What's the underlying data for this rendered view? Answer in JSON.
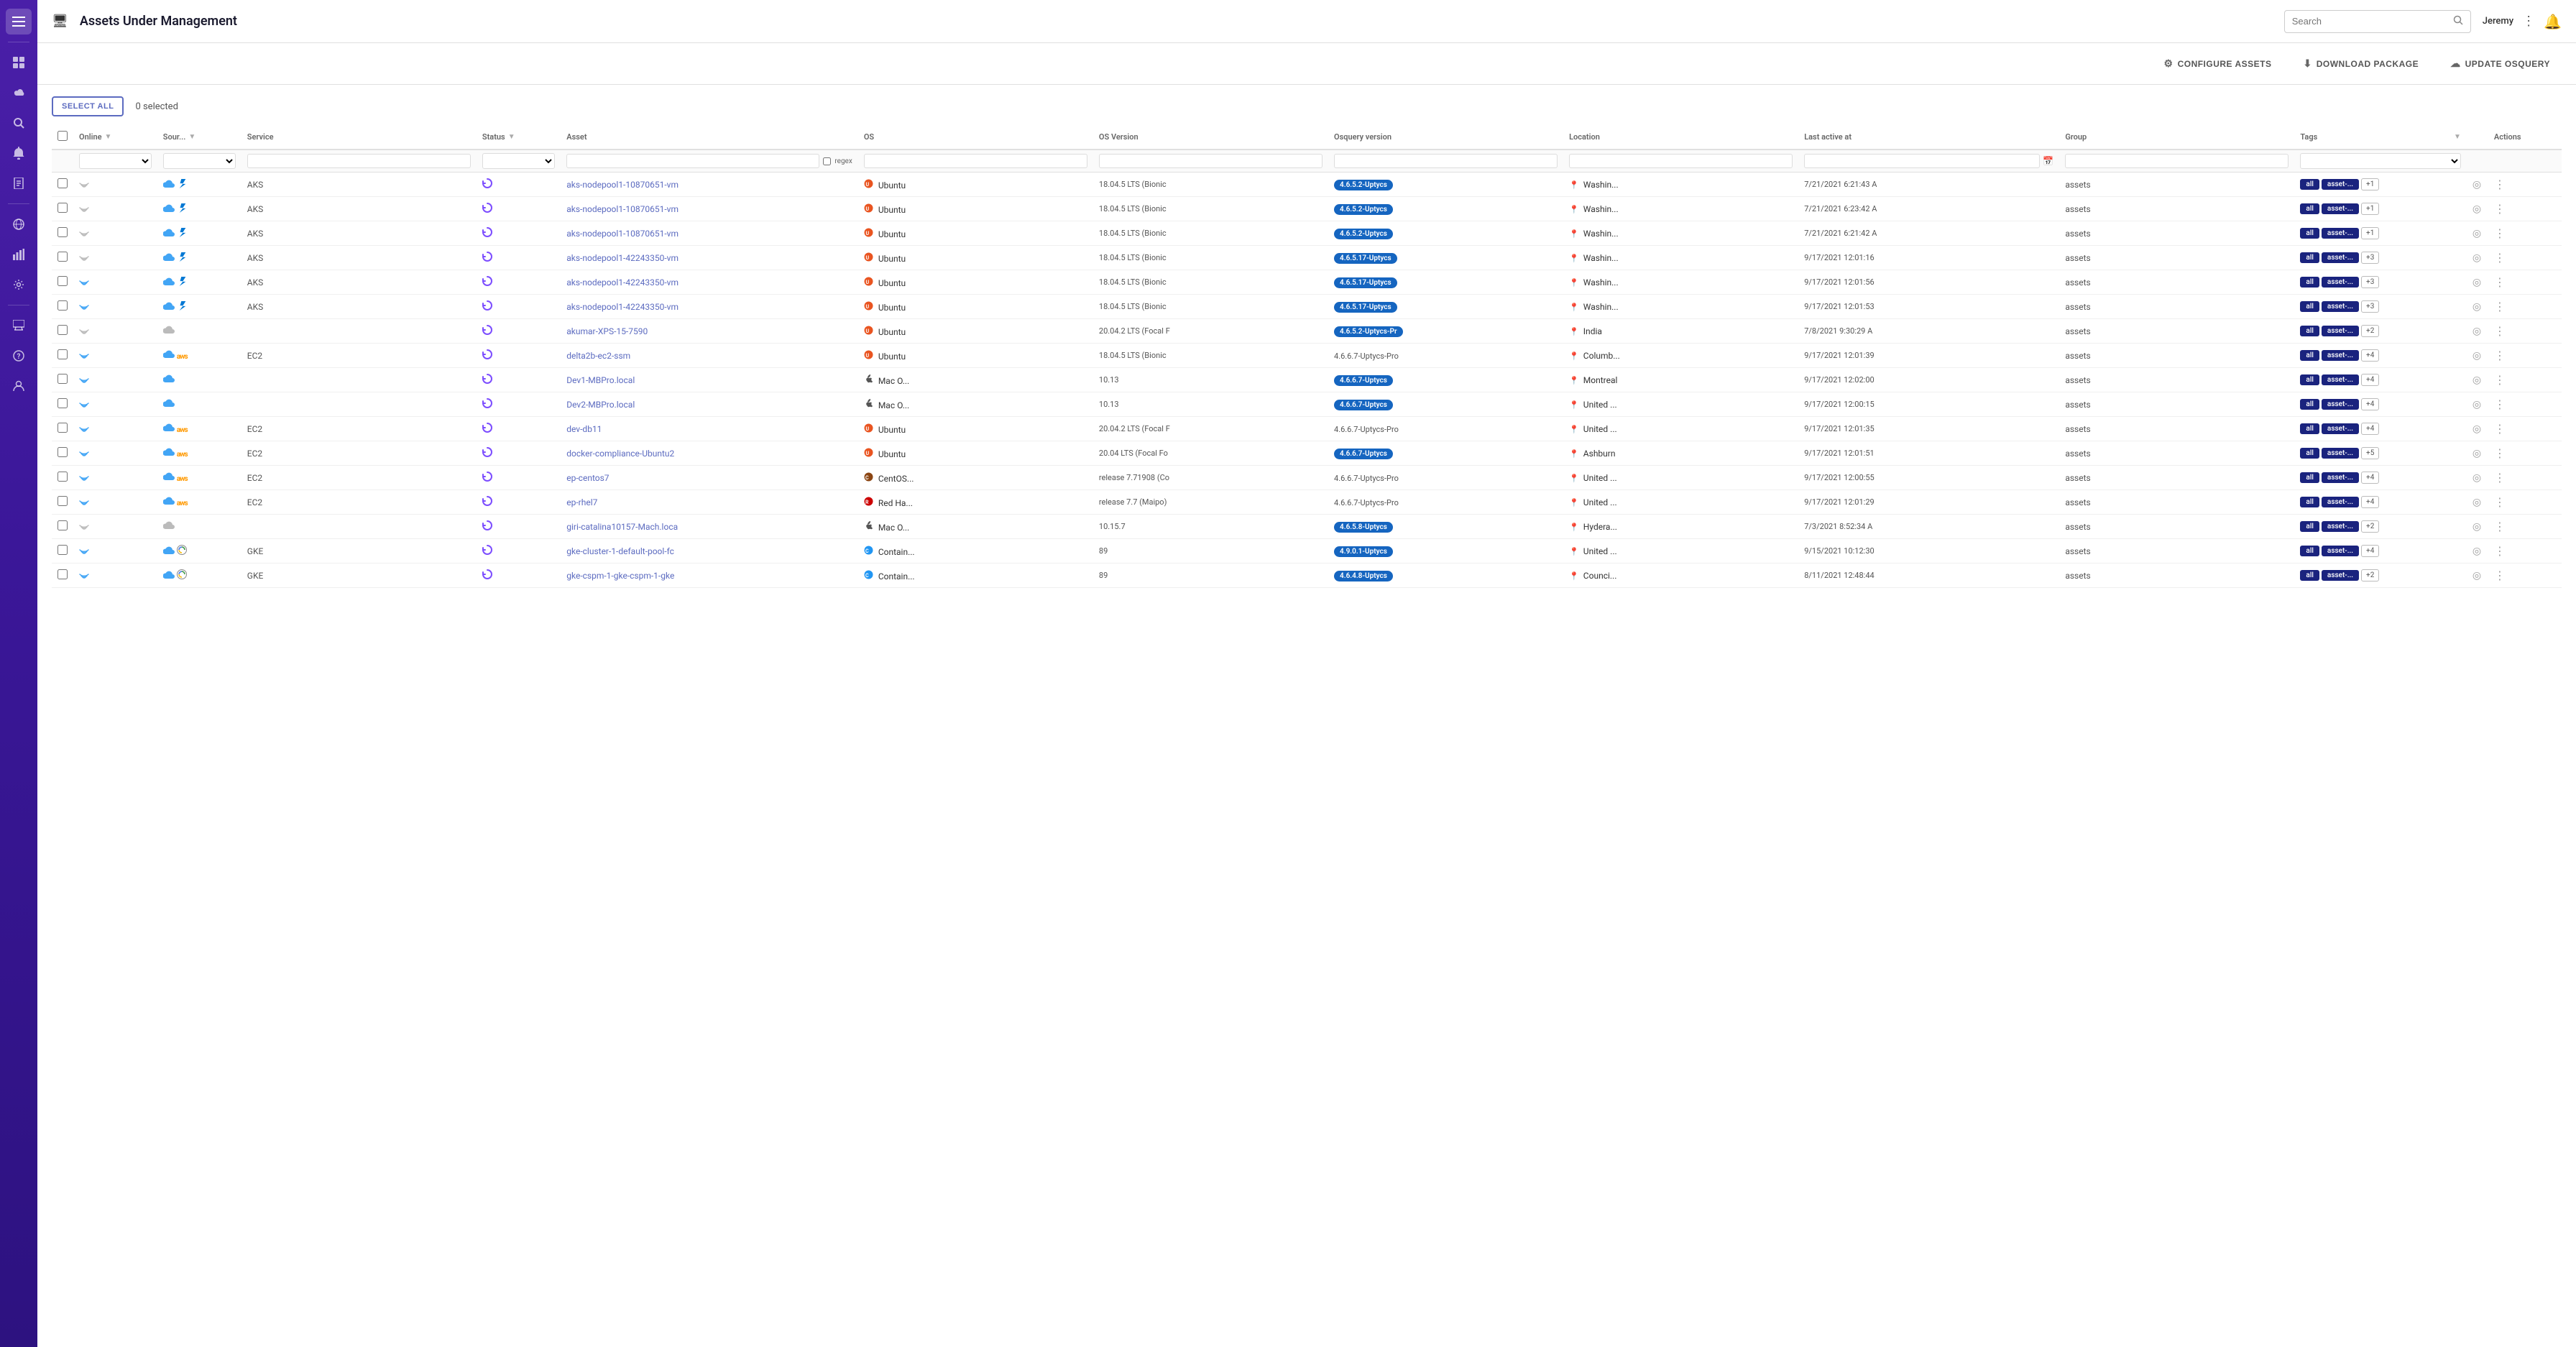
{
  "app": {
    "title": "Assets Under Management",
    "monitor_icon": "🖥",
    "hamburger_label": "☰"
  },
  "topbar": {
    "search_placeholder": "Search",
    "user_name": "Jeremy",
    "notification_icon": "🔔",
    "more_icon": "⋮"
  },
  "action_bar": {
    "configure_label": "CONFIGURE ASSETS",
    "download_label": "DOWNLOAD PACKAGE",
    "update_label": "UPDATE OSQUERY",
    "gear_icon": "⚙",
    "download_icon": "⬇",
    "cloud_icon": "☁"
  },
  "table": {
    "select_all_label": "SELECT ALL",
    "selected_count": "0 selected",
    "columns": [
      "",
      "Online",
      "Sour...",
      "Service",
      "Status",
      "Asset",
      "OS",
      "OS Version",
      "Osquery version",
      "Location",
      "Last active at",
      "Group",
      "Tags",
      "",
      "Actions"
    ],
    "regex_label": "regex",
    "rows": [
      {
        "online": "offline",
        "source": "cloud",
        "source_type": "azure",
        "service": "AKS",
        "status": "sync",
        "asset": "aks-nodepool1-10870651-vm",
        "os": "ubuntu",
        "os_name": "Ubuntu",
        "os_version": "18.04.5 LTS (Bionic",
        "osquery": "4.6.5.2-Uptycs",
        "location": "Washin...",
        "last_active": "7/21/2021 6:21:43 A",
        "group": "assets",
        "tags": [
          "all",
          "asset-...",
          "+1"
        ]
      },
      {
        "online": "offline",
        "source": "cloud",
        "source_type": "azure",
        "service": "AKS",
        "status": "sync",
        "asset": "aks-nodepool1-10870651-vm",
        "os": "ubuntu",
        "os_name": "Ubuntu",
        "os_version": "18.04.5 LTS (Bionic",
        "osquery": "4.6.5.2-Uptycs",
        "location": "Washin...",
        "last_active": "7/21/2021 6:23:42 A",
        "group": "assets",
        "tags": [
          "all",
          "asset-...",
          "+1"
        ]
      },
      {
        "online": "offline",
        "source": "cloud",
        "source_type": "azure",
        "service": "AKS",
        "status": "sync",
        "asset": "aks-nodepool1-10870651-vm",
        "os": "ubuntu",
        "os_name": "Ubuntu",
        "os_version": "18.04.5 LTS (Bionic",
        "osquery": "4.6.5.2-Uptycs",
        "location": "Washin...",
        "last_active": "7/21/2021 6:21:42 A",
        "group": "assets",
        "tags": [
          "all",
          "asset-...",
          "+1"
        ]
      },
      {
        "online": "offline",
        "source": "cloud",
        "source_type": "azure",
        "service": "AKS",
        "status": "sync",
        "asset": "aks-nodepool1-42243350-vm",
        "os": "ubuntu",
        "os_name": "Ubuntu",
        "os_version": "18.04.5 LTS (Bionic",
        "osquery": "4.6.5.17-Uptycs",
        "location": "Washin...",
        "last_active": "9/17/2021 12:01:16",
        "group": "assets",
        "tags": [
          "all",
          "asset-...",
          "+3"
        ]
      },
      {
        "online": "online",
        "source": "cloud",
        "source_type": "azure",
        "service": "AKS",
        "status": "sync",
        "asset": "aks-nodepool1-42243350-vm",
        "os": "ubuntu",
        "os_name": "Ubuntu",
        "os_version": "18.04.5 LTS (Bionic",
        "osquery": "4.6.5.17-Uptycs",
        "location": "Washin...",
        "last_active": "9/17/2021 12:01:56",
        "group": "assets",
        "tags": [
          "all",
          "asset-...",
          "+3"
        ]
      },
      {
        "online": "online",
        "source": "cloud",
        "source_type": "azure",
        "service": "AKS",
        "status": "sync",
        "asset": "aks-nodepool1-42243350-vm",
        "os": "ubuntu",
        "os_name": "Ubuntu",
        "os_version": "18.04.5 LTS (Bionic",
        "osquery": "4.6.5.17-Uptycs",
        "location": "Washin...",
        "last_active": "9/17/2021 12:01:53",
        "group": "assets",
        "tags": [
          "all",
          "asset-...",
          "+3"
        ]
      },
      {
        "online": "offline",
        "source": "none",
        "source_type": "",
        "service": "",
        "status": "sync",
        "asset": "akumar-XPS-15-7590",
        "os": "ubuntu",
        "os_name": "Ubuntu",
        "os_version": "20.04.2 LTS (Focal F",
        "osquery": "4.6.5.2-Uptycs-Pr",
        "location": "India",
        "last_active": "7/8/2021 9:30:29 A",
        "group": "assets",
        "tags": [
          "all",
          "asset-...",
          "+2"
        ]
      },
      {
        "online": "online",
        "source": "cloud",
        "source_type": "aws",
        "service": "EC2",
        "status": "sync",
        "asset": "delta2b-ec2-ssm",
        "os": "ubuntu",
        "os_name": "Ubuntu",
        "os_version": "18.04.5 LTS (Bionic",
        "osquery": "4.6.6.7-Uptycs-Pro",
        "location": "Columb...",
        "last_active": "9/17/2021 12:01:39",
        "group": "assets",
        "tags": [
          "all",
          "asset-...",
          "+4"
        ]
      },
      {
        "online": "online",
        "source": "cloud",
        "source_type": "",
        "service": "",
        "status": "sync",
        "asset": "Dev1-MBPro.local",
        "os": "mac",
        "os_name": "Mac O...",
        "os_version": "10.13",
        "osquery": "4.6.6.7-Uptycs",
        "location": "Montreal",
        "last_active": "9/17/2021 12:02:00",
        "group": "assets",
        "tags": [
          "all",
          "asset-...",
          "+4"
        ]
      },
      {
        "online": "online",
        "source": "cloud",
        "source_type": "",
        "service": "",
        "status": "sync",
        "asset": "Dev2-MBPro.local",
        "os": "mac",
        "os_name": "Mac O...",
        "os_version": "10.13",
        "osquery": "4.6.6.7-Uptycs",
        "location": "United ...",
        "last_active": "9/17/2021 12:00:15",
        "group": "assets",
        "tags": [
          "all",
          "asset-...",
          "+4"
        ]
      },
      {
        "online": "online",
        "source": "cloud",
        "source_type": "aws",
        "service": "EC2",
        "status": "sync",
        "asset": "dev-db11",
        "os": "ubuntu",
        "os_name": "Ubuntu",
        "os_version": "20.04.2 LTS (Focal F",
        "osquery": "4.6.6.7-Uptycs-Pro",
        "location": "United ...",
        "last_active": "9/17/2021 12:01:35",
        "group": "assets",
        "tags": [
          "all",
          "asset-...",
          "+4"
        ]
      },
      {
        "online": "online",
        "source": "cloud",
        "source_type": "aws",
        "service": "EC2",
        "status": "sync",
        "asset": "docker-compliance-Ubuntu2",
        "os": "ubuntu",
        "os_name": "Ubuntu",
        "os_version": "20.04 LTS (Focal Fo",
        "osquery": "4.6.6.7-Uptycs",
        "location": "Ashburn",
        "last_active": "9/17/2021 12:01:51",
        "group": "assets",
        "tags": [
          "all",
          "asset-...",
          "+5"
        ]
      },
      {
        "online": "online",
        "source": "cloud",
        "source_type": "aws",
        "service": "EC2",
        "status": "sync",
        "asset": "ep-centos7",
        "os": "centos",
        "os_name": "CentOS...",
        "os_version": "release 7.71908 (Co",
        "osquery": "4.6.6.7-Uptycs-Pro",
        "location": "United ...",
        "last_active": "9/17/2021 12:00:55",
        "group": "assets",
        "tags": [
          "all",
          "asset-...",
          "+4"
        ]
      },
      {
        "online": "online",
        "source": "cloud",
        "source_type": "aws",
        "service": "EC2",
        "status": "sync",
        "asset": "ep-rhel7",
        "os": "redhat",
        "os_name": "Red Ha...",
        "os_version": "release 7.7 (Maipo)",
        "osquery": "4.6.6.7-Uptycs-Pro",
        "location": "United ...",
        "last_active": "9/17/2021 12:01:29",
        "group": "assets",
        "tags": [
          "all",
          "asset-...",
          "+4"
        ]
      },
      {
        "online": "offline",
        "source": "none",
        "source_type": "",
        "service": "",
        "status": "sync",
        "asset": "giri-catalina10157-Mach.loca",
        "os": "mac",
        "os_name": "Mac O...",
        "os_version": "10.15.7",
        "osquery": "4.6.5.8-Uptycs",
        "location": "Hydera...",
        "last_active": "7/3/2021 8:52:34 A",
        "group": "assets",
        "tags": [
          "all",
          "asset-...",
          "+2"
        ]
      },
      {
        "online": "online",
        "source": "cloud",
        "source_type": "gke",
        "service": "GKE",
        "status": "sync",
        "asset": "gke-cluster-1-default-pool-fc",
        "os": "container",
        "os_name": "Contain...",
        "os_version": "89",
        "osquery": "4.9.0.1-Uptycs",
        "location": "United ...",
        "last_active": "9/15/2021 10:12:30",
        "group": "assets",
        "tags": [
          "all",
          "asset-...",
          "+4"
        ]
      },
      {
        "online": "online",
        "source": "cloud",
        "source_type": "gke",
        "service": "GKE",
        "status": "sync",
        "asset": "gke-cspm-1-gke-cspm-1-gke",
        "os": "container",
        "os_name": "Contain...",
        "os_version": "89",
        "osquery": "4.6.4.8-Uptycs",
        "location": "Counci...",
        "last_active": "8/11/2021 12:48:44",
        "group": "assets",
        "tags": [
          "all",
          "asset-...",
          "+2"
        ]
      }
    ]
  },
  "sidebar": {
    "items": [
      {
        "icon": "☰",
        "name": "menu"
      },
      {
        "icon": "📊",
        "name": "dashboard"
      },
      {
        "icon": "☁",
        "name": "cloud"
      },
      {
        "icon": "🔍",
        "name": "detect"
      },
      {
        "icon": "🔔",
        "name": "alerts"
      },
      {
        "icon": "📋",
        "name": "compliance"
      },
      {
        "icon": "🗺",
        "name": "threat-map"
      },
      {
        "icon": "📈",
        "name": "reports"
      },
      {
        "icon": "⚙",
        "name": "settings"
      },
      {
        "icon": "💻",
        "name": "assets"
      },
      {
        "icon": "❓",
        "name": "help"
      },
      {
        "icon": "👤",
        "name": "user"
      }
    ]
  }
}
